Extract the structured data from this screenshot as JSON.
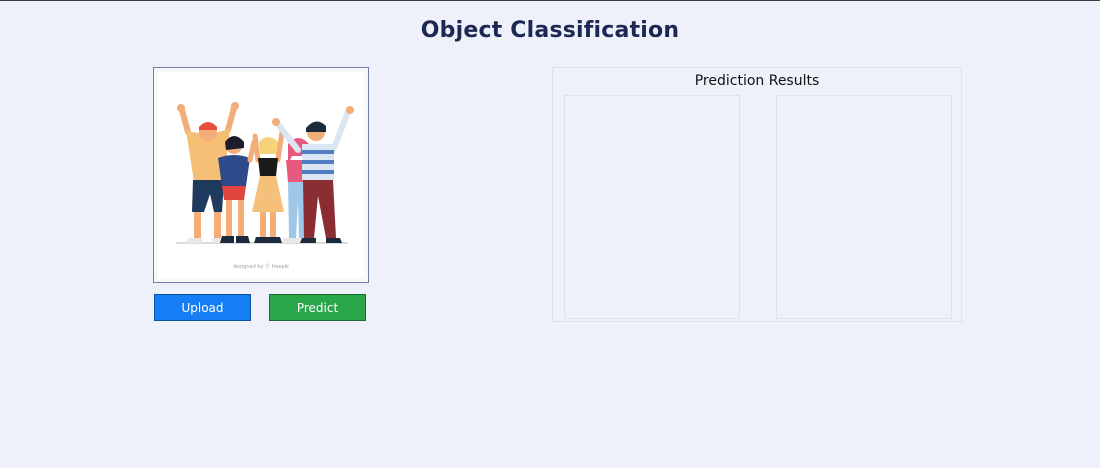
{
  "header": {
    "title": "Object Classification"
  },
  "image_preview": {
    "credit": "designed by Ⓕ freepik",
    "icon": "group-people-illustration"
  },
  "actions": {
    "upload_label": "Upload",
    "predict_label": "Predict",
    "upload_color": "#157ef5",
    "predict_color": "#2aa64a"
  },
  "results": {
    "title": "Prediction Results"
  }
}
